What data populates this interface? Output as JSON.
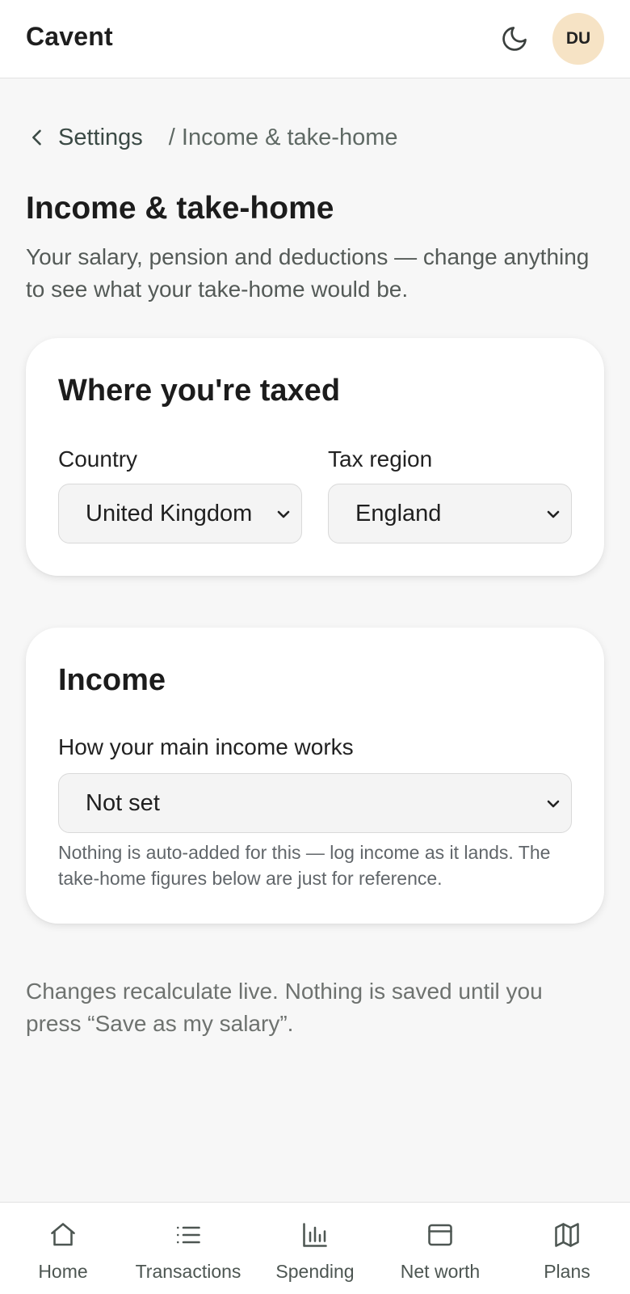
{
  "header": {
    "brand": "Cavent",
    "theme_toggle_icon": "moon-icon",
    "avatar_initials": "DU",
    "avatar_color": "#f6e3c5"
  },
  "breadcrumb": {
    "back_label": "Settings",
    "current": "/ Income & take-home"
  },
  "page": {
    "title": "Income & take-home",
    "subtitle": "Your salary, pension and deductions — change anything to see what your take-home would be."
  },
  "tax_card": {
    "title": "Where you're taxed",
    "country": {
      "label": "Country",
      "value": "United Kingdom"
    },
    "region": {
      "label": "Tax region",
      "value": "England"
    }
  },
  "income_card": {
    "title": "Income",
    "mode": {
      "label": "How your main income works",
      "value": "Not set"
    },
    "helper": "Nothing is auto-added for this — log income as it lands. The take-home figures below are just for reference."
  },
  "footnote": "Changes recalculate live. Nothing is saved until you press “Save as my salary”.",
  "bottom_nav": [
    {
      "label": "Home",
      "icon": "home-icon"
    },
    {
      "label": "Transactions",
      "icon": "list-icon"
    },
    {
      "label": "Spending",
      "icon": "bar-chart-icon"
    },
    {
      "label": "Net worth",
      "icon": "wallet-icon"
    },
    {
      "label": "Plans",
      "icon": "map-icon"
    }
  ]
}
